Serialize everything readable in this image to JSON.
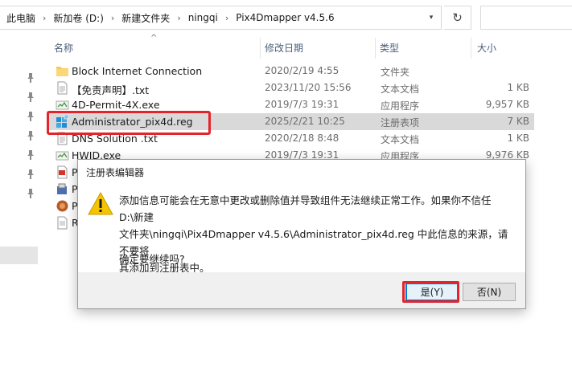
{
  "address_bar": {
    "breadcrumbs": [
      "此电脑",
      "新加卷 (D:)",
      "新建文件夹",
      "ningqi",
      "Pix4Dmapper v4.5.6"
    ]
  },
  "columns": {
    "name": "名称",
    "date": "修改日期",
    "type": "类型",
    "size": "大小"
  },
  "files": [
    {
      "name": "Block Internet Connection",
      "date": "2020/2/19 4:55",
      "type": "文件夹",
      "size": "",
      "icon": "folder-icon"
    },
    {
      "name": "【免责声明】.txt",
      "date": "2023/11/20 15:56",
      "type": "文本文档",
      "size": "1 KB",
      "icon": "text-file-icon"
    },
    {
      "name": "4D-Permit-4X.exe",
      "date": "2019/7/3 19:31",
      "type": "应用程序",
      "size": "9,957 KB",
      "icon": "exe-file-icon"
    },
    {
      "name": "Administrator_pix4d.reg",
      "date": "2025/2/21 10:25",
      "type": "注册表项",
      "size": "7 KB",
      "icon": "registry-file-icon"
    },
    {
      "name": "DNS Solution .txt",
      "date": "2020/2/18 8:48",
      "type": "文本文档",
      "size": "1 KB",
      "icon": "text-file-icon"
    },
    {
      "name": "HWID.exe",
      "date": "2019/7/3 19:31",
      "type": "应用程序",
      "size": "9,976 KB",
      "icon": "exe-file-icon"
    }
  ],
  "partial_rows": [
    "P",
    "P",
    "P",
    "R"
  ],
  "dialog": {
    "title": "注册表编辑器",
    "message_line1": "添加信息可能会在无意中更改或删除值并导致组件无法继续正常工作。如果你不信任 D:\\新建",
    "message_line2": "文件夹\\ningqi\\Pix4Dmapper v4.5.6\\Administrator_pix4d.reg 中此信息的来源，请不要将",
    "message_line3": "其添加到注册表中。",
    "confirm": "确定要继续吗?",
    "yes_label": "是(Y)",
    "no_label": "否(N)"
  },
  "colors": {
    "highlight": "#e3242b",
    "accent": "#0078d7",
    "folder": "#f7c95b"
  }
}
